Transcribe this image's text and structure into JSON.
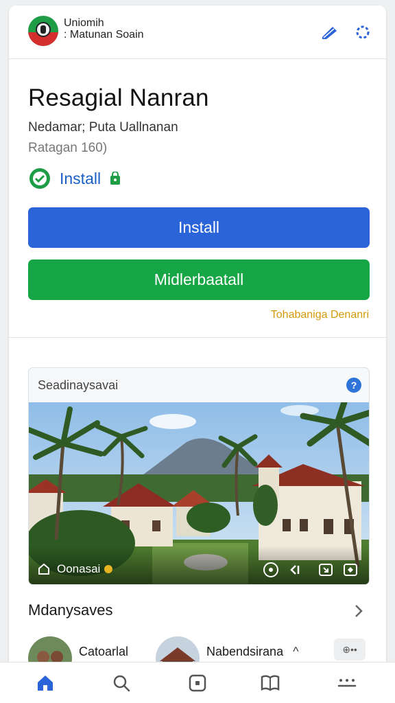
{
  "header": {
    "brand_line1": "Uniomih",
    "brand_line2": ": Matunan Soain"
  },
  "app": {
    "title": "Resagial Nanran",
    "developer": "Nedamar; Puta Uallnanan",
    "rating": "Ratagan 160)",
    "badge_label": "Install"
  },
  "buttons": {
    "primary": "Install",
    "secondary": "Midlerbaatall"
  },
  "link_text": "Tohabaniga Denanri",
  "preview": {
    "title": "Seadinaysavai",
    "help_glyph": "?",
    "caption": "Oonasai"
  },
  "section": {
    "title": "Mdanysaves",
    "items": [
      {
        "name": "Catoarlal",
        "arrow": ""
      },
      {
        "name": "Nabendsirana",
        "arrow": "^"
      }
    ],
    "chip_label": "⊕••"
  },
  "nav": {
    "items": [
      "home-icon",
      "search-icon",
      "apps-icon",
      "library-icon",
      "more-icon"
    ],
    "active": "home-icon"
  },
  "colors": {
    "accent_blue": "#2b63d9",
    "accent_green": "#17a646",
    "link_yellow": "#d49b08",
    "badge_green": "#1e9c46"
  }
}
